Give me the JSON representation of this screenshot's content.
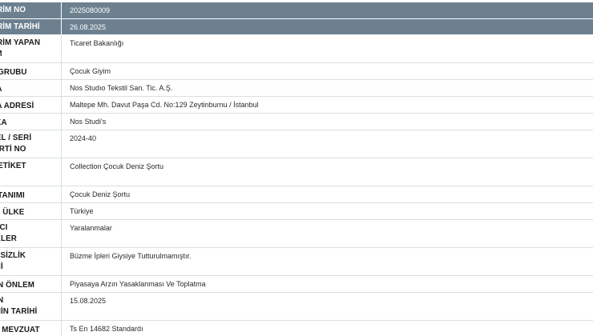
{
  "header_rows": [
    {
      "label": "LDİRİM NO",
      "value": "2025080009"
    },
    {
      "label": "LDİRİM TARİHİ",
      "value": "26.08.2025"
    }
  ],
  "rows": [
    {
      "label_lines": [
        "LDİRİM YAPAN",
        "RUM"
      ],
      "value": "Ticaret Bakanlığı"
    },
    {
      "label_lines": [
        "ÜN GRUBU"
      ],
      "value": "Çocuk Giyim"
    },
    {
      "label_lines": [
        "RMA"
      ],
      "value": "Nos Studıo Tekstil San. Tic. A.Ş."
    },
    {
      "label_lines": [
        "RMA ADRESİ"
      ],
      "value": "Maltepe Mh. Davut Paşa Cd. No:129 Zeytinburnu / İstanbul"
    },
    {
      "label_lines": [
        "ARKA"
      ],
      "value": "Nos Studi's"
    },
    {
      "label_lines": [
        "ODEL / SERİ",
        "/ PARTİ NO"
      ],
      "value": "2024-40"
    },
    {
      "label_lines": [
        "ÜN ETİKET",
        "I"
      ],
      "value": "Collection Çocuk Deniz Şortu"
    },
    {
      "label_lines": [
        "ÜN TANIMI"
      ],
      "value": "Çocuk Deniz Şortu"
    },
    {
      "label_lines": [
        "NŞE ÜLKE"
      ],
      "value": "Türkiye"
    },
    {
      "label_lines": [
        "ŞIDICI",
        "KEKLER"
      ],
      "value": "Yaralanmalar"
    },
    {
      "label_lines": [
        "VENSİZLİK",
        "DENİ"
      ],
      "value": "Büzme İpleri Giysiye Tutturulmamıştır."
    },
    {
      "label_lines": [
        "INAN ÖNLEM"
      ],
      "value": "Piyasaya Arzın Yasaklanması Ve Toplatma"
    },
    {
      "label_lines": [
        "INAN",
        "LEMİN TARİHİ"
      ],
      "value": "15.08.2025"
    },
    {
      "label_lines": [
        "GİLİ MEVZUAT"
      ],
      "value": "Ts En 14682 Standardı"
    }
  ]
}
